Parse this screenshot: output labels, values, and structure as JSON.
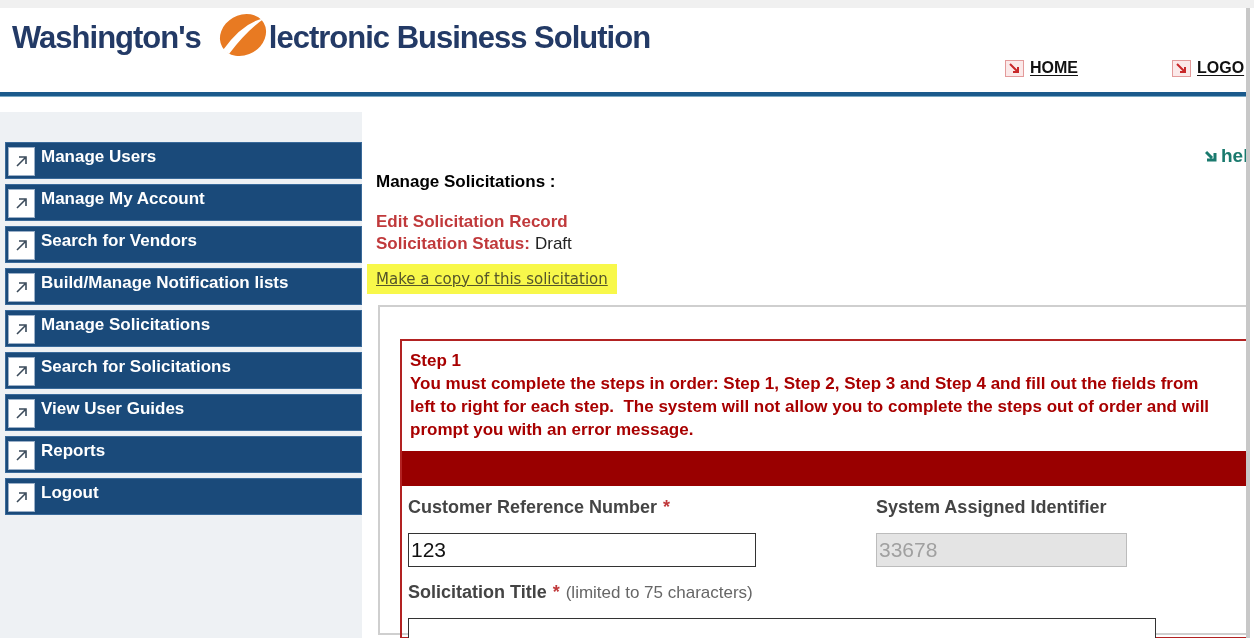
{
  "header": {
    "logo": {
      "before": "Washington's",
      "after": "lectronic Business Solution"
    },
    "links": [
      {
        "label": "HOME"
      },
      {
        "label": "LOGO"
      }
    ]
  },
  "help_link": "hel",
  "sidebar": {
    "items": [
      {
        "label": "Manage Users"
      },
      {
        "label": "Manage My Account"
      },
      {
        "label": "Search for Vendors"
      },
      {
        "label": "Build/Manage Notification lists"
      },
      {
        "label": "Manage Solicitations"
      },
      {
        "label": "Search for Solicitations"
      },
      {
        "label": "View User Guides"
      },
      {
        "label": "Reports"
      },
      {
        "label": "Logout"
      }
    ]
  },
  "page": {
    "heading": "Manage Solicitations :",
    "subheading": "Edit Solicitation Record",
    "status_label": "Solicitation Status:",
    "status_value": "Draft",
    "copy_link": {
      "label": "Make a copy of this solicitation",
      "highlighted": true
    }
  },
  "step": {
    "title": "Step 1",
    "instructions": "You must complete the steps in order: Step 1, Step 2, Step 3 and Step 4 and fill out the fields from left to right for each step.  The system will not allow you to complete the steps out of order and will prompt you with an error message."
  },
  "fields": [
    {
      "label": "Customer Reference Number",
      "required_mark": "*",
      "value": "123",
      "disabled": false
    },
    {
      "label": "System Assigned Identifier",
      "value": "33678",
      "disabled": true
    },
    {
      "label": "Solicitation Title",
      "required_mark": "*",
      "hint": "(limited to 75 characters)",
      "disabled": false
    }
  ]
}
